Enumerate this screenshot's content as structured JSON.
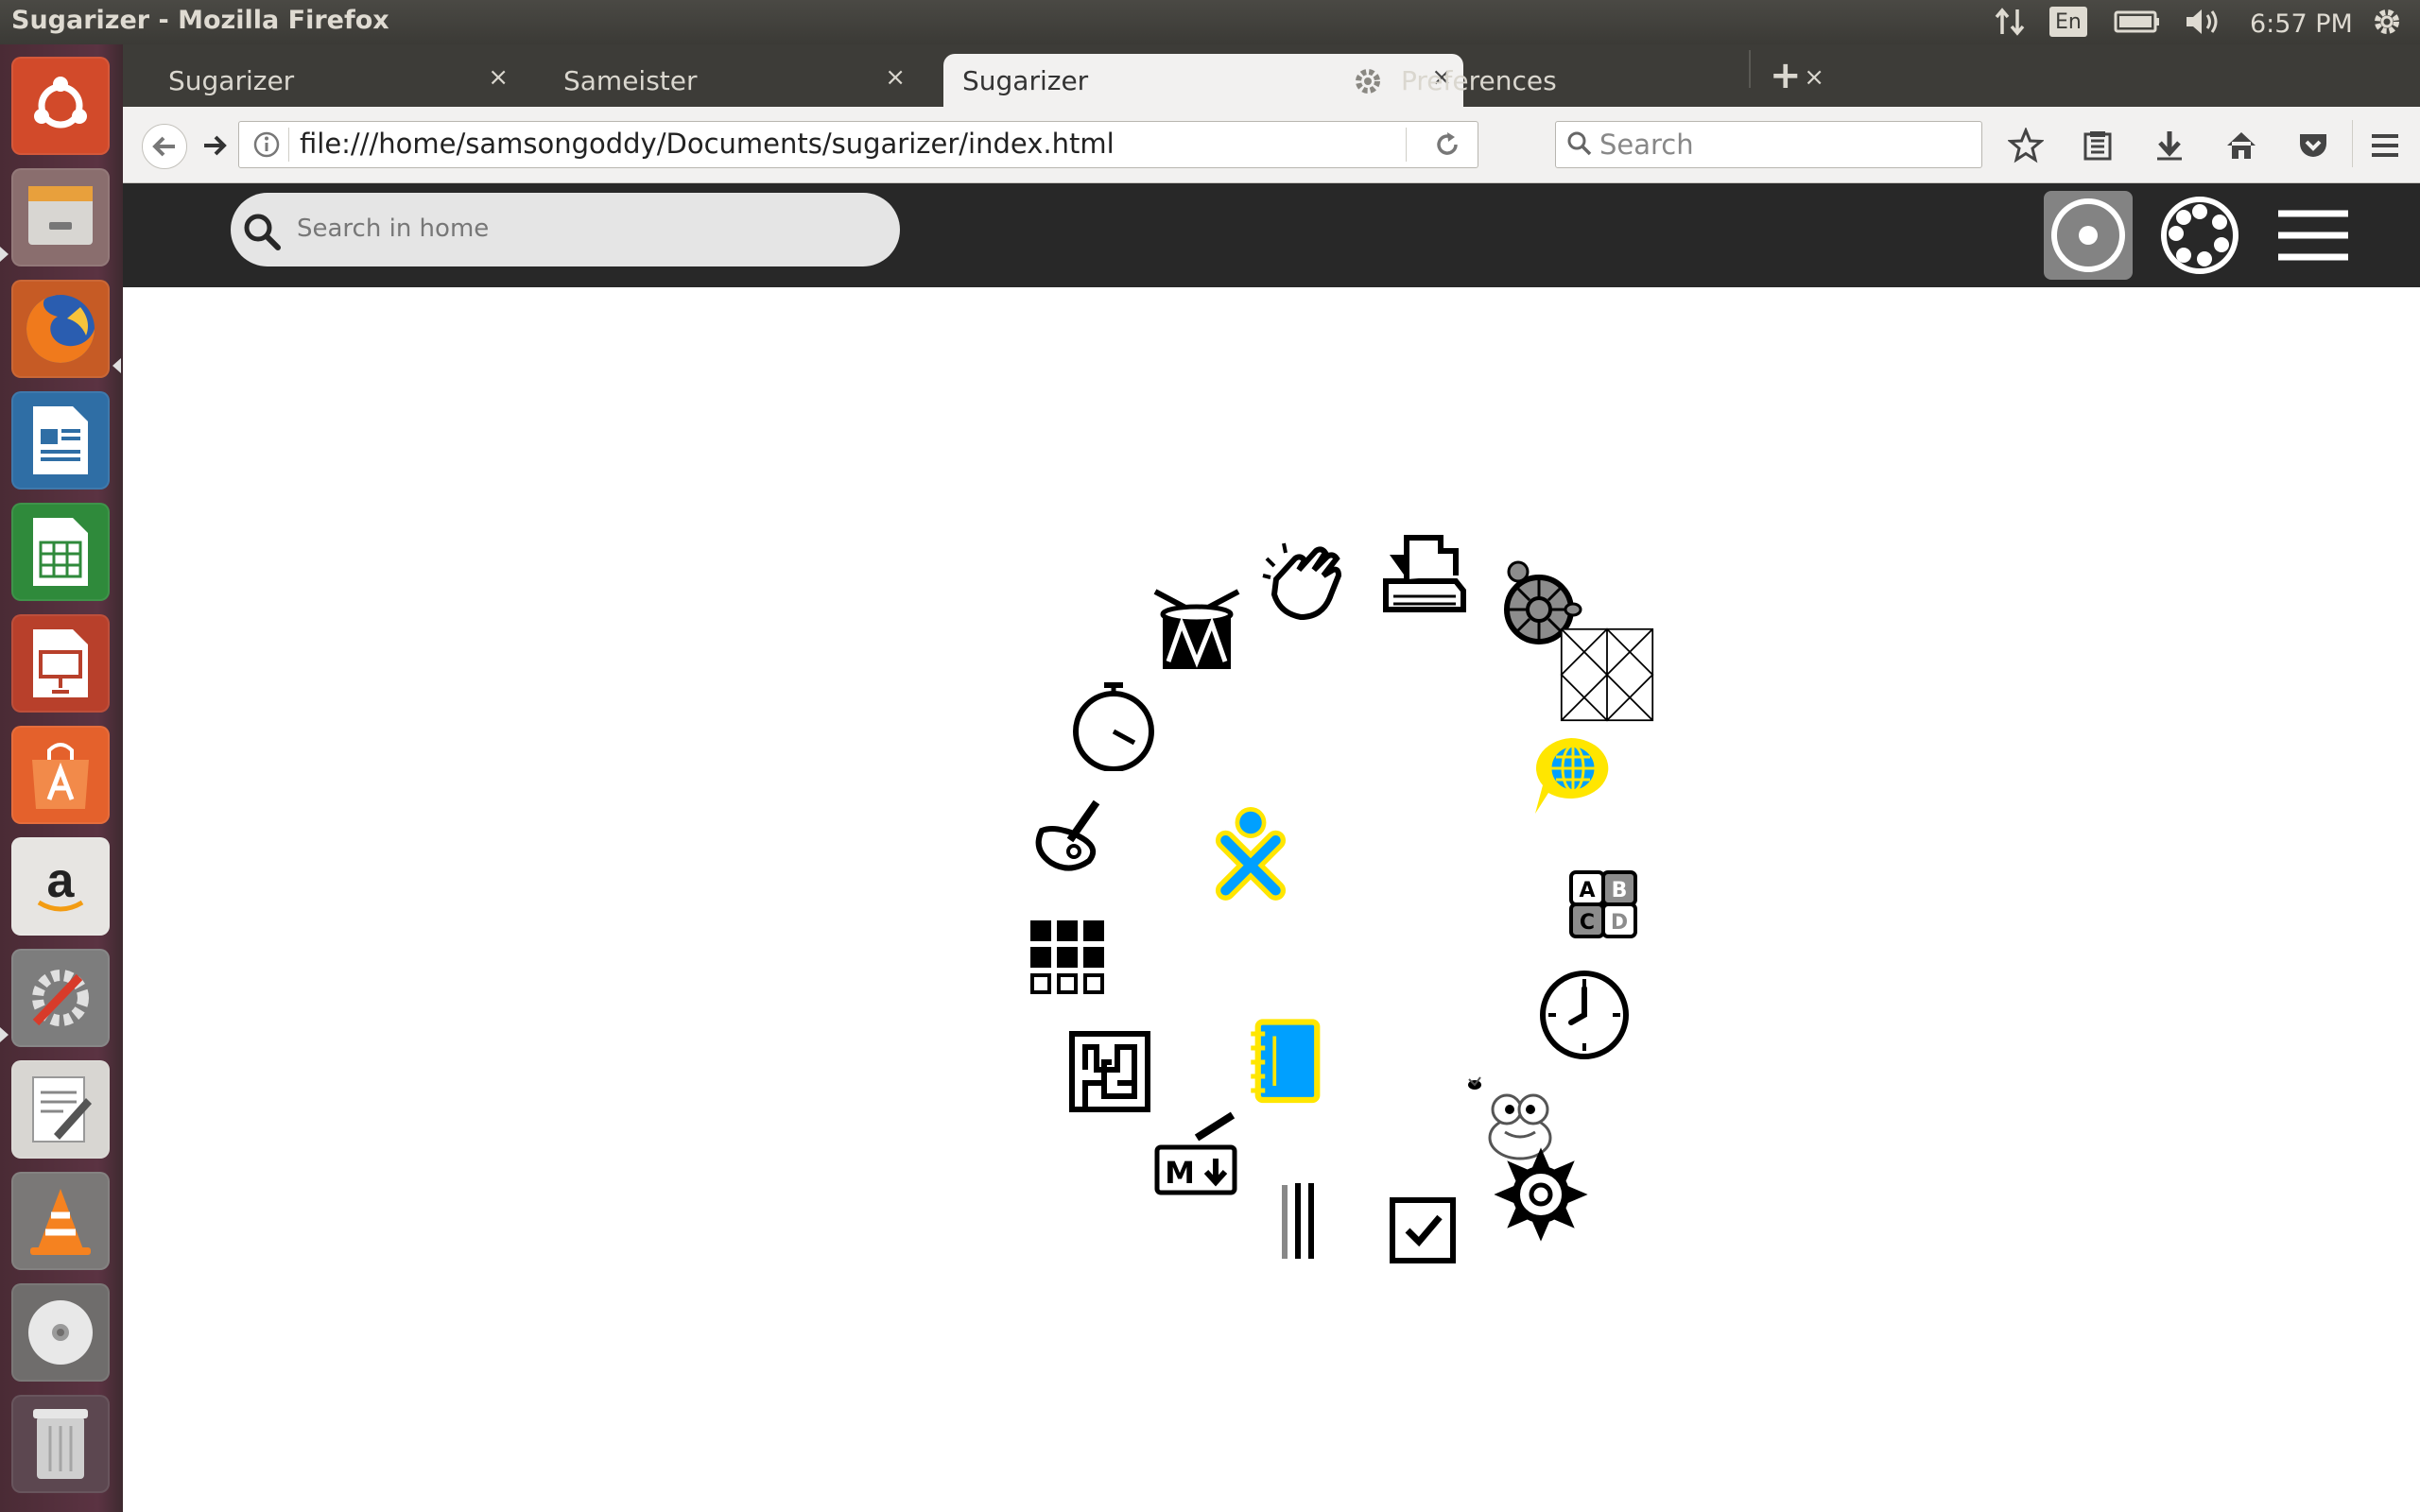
{
  "window": {
    "title": "Sugarizer - Mozilla Firefox"
  },
  "tray": {
    "language": "En",
    "time": "6:57 PM"
  },
  "launcher": {
    "items": [
      "dash-home",
      "files",
      "firefox",
      "writer",
      "calc",
      "impress",
      "software-center",
      "amazon",
      "system-settings",
      "text-editor",
      "vlc",
      "dvd",
      "trash"
    ]
  },
  "browser": {
    "tabs": [
      {
        "label": "Sugarizer",
        "close": "×"
      },
      {
        "label": "Sameister",
        "close": "×"
      },
      {
        "label": "Sugarizer",
        "close": "×"
      },
      {
        "label": "Preferences",
        "close": "×"
      }
    ],
    "new_tab": "+",
    "url": "file:///home/samsongoddy/Documents/sugarizer/index.html",
    "search_placeholder": "Search"
  },
  "sugar": {
    "search_placeholder": "Search in home",
    "colors": {
      "stroke": "#00a0ff",
      "fill": "#ffe600",
      "toolbar": "#282828"
    },
    "activities": [
      "chat-activity",
      "abecedarium-activity",
      "clock-activity",
      "frog-activity",
      "settings-activity",
      "checklist-activity",
      "tally-activity",
      "markdown-activity",
      "labyrinth-activity",
      "grid-activity",
      "paint-activity",
      "stopwatch-activity",
      "drum-activity",
      "clap-activity",
      "journal-files-activity",
      "turtle-activity",
      "tangram-activity"
    ]
  }
}
